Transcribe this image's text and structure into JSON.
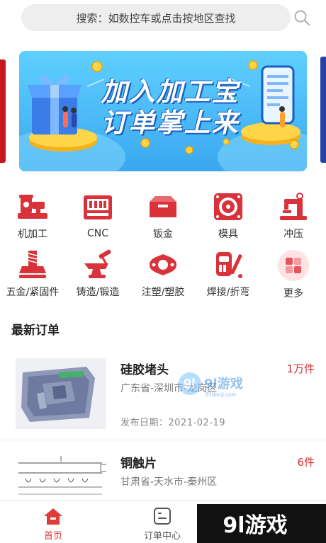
{
  "search": {
    "placeholder": "搜索：如数控车或点击按地区查找",
    "icon": "search-icon"
  },
  "banner": {
    "title_line1": "加入加工宝",
    "title_line2": "订单掌上来"
  },
  "categories": [
    {
      "label": "机加工",
      "icon": "lathe-machine-icon"
    },
    {
      "label": "CNC",
      "icon": "cnc-machine-icon"
    },
    {
      "label": "钣金",
      "icon": "sheet-metal-icon"
    },
    {
      "label": "模具",
      "icon": "mold-icon"
    },
    {
      "label": "冲压",
      "icon": "stamping-press-icon"
    },
    {
      "label": "五金/紧固件",
      "icon": "bolt-icon"
    },
    {
      "label": "铸造/锻造",
      "icon": "anvil-icon"
    },
    {
      "label": "注塑/塑胶",
      "icon": "injection-part-icon"
    },
    {
      "label": "焊接/折弯",
      "icon": "welding-icon"
    },
    {
      "label": "更多",
      "icon": "more-grid-icon"
    }
  ],
  "section": {
    "title": "最新订单"
  },
  "orders": [
    {
      "title": "硅胶堵头",
      "quantity": "1万件",
      "location": "广东省-深圳市-龙岗区",
      "date": "发布日期：2021-02-19"
    },
    {
      "title": "铜触片",
      "quantity": "6件",
      "location": "甘肃省-天水市-秦州区",
      "date": ""
    }
  ],
  "bottom_nav": [
    {
      "label": "首页",
      "icon": "home-icon",
      "active": true
    },
    {
      "label": "订单中心",
      "icon": "order-center-icon",
      "active": false
    }
  ],
  "watermark": {
    "brand": "9l游戏",
    "domain": "91danji.com"
  },
  "colors": {
    "accent": "#d32f2f",
    "banner_bg": "#4bbaf5",
    "icon_red": "#d9323a"
  }
}
